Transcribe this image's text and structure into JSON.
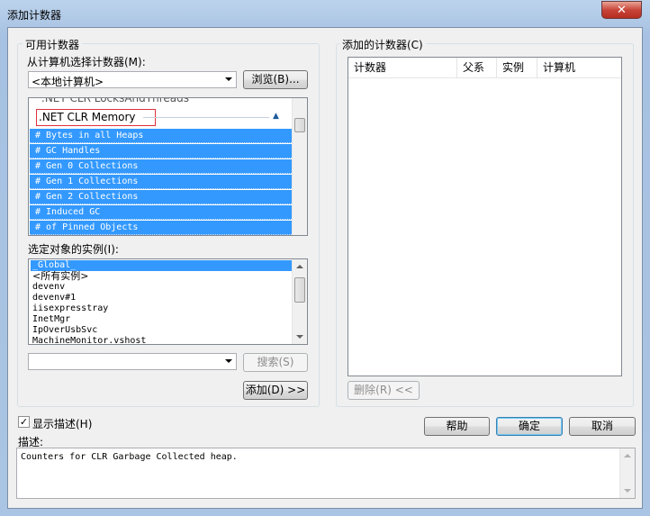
{
  "window": {
    "title": "添加计数器",
    "close_label": "✕"
  },
  "available": {
    "group_label": "可用计数器",
    "from_label": "从计算机选择计数器(M):",
    "computer_value": "<本地计算机>",
    "browse_label": "浏览(B)...",
    "partial_top": ".NET CLR LocksAndThreads",
    "category": ".NET CLR Memory",
    "counters": [
      "# Bytes in all Heaps",
      "# GC Handles",
      "# Gen 0 Collections",
      "# Gen 1 Collections",
      "# Gen 2 Collections",
      "# Induced GC",
      "# of Pinned Objects"
    ]
  },
  "instances": {
    "label": "选定对象的实例(I):",
    "items": [
      "_Global_",
      "<所有实例>",
      "devenv",
      "devenv#1",
      "iisexpresstray",
      "InetMgr",
      "IpOverUsbSvc",
      "MachineMonitor.vshost"
    ]
  },
  "search": {
    "value": "",
    "button_label": "搜索(S)"
  },
  "add_button_label": "添加(D) >>",
  "added": {
    "group_label": "添加的计数器(C)",
    "columns": [
      "计数器",
      "父系",
      "实例",
      "计算机"
    ],
    "remove_label": "删除(R) <<"
  },
  "show_desc": {
    "label": "显示描述(H)",
    "checked": "✓"
  },
  "buttons": {
    "help": "帮助",
    "ok": "确定",
    "cancel": "取消"
  },
  "description": {
    "label": "描述:",
    "text": "Counters for CLR Garbage Collected heap."
  }
}
